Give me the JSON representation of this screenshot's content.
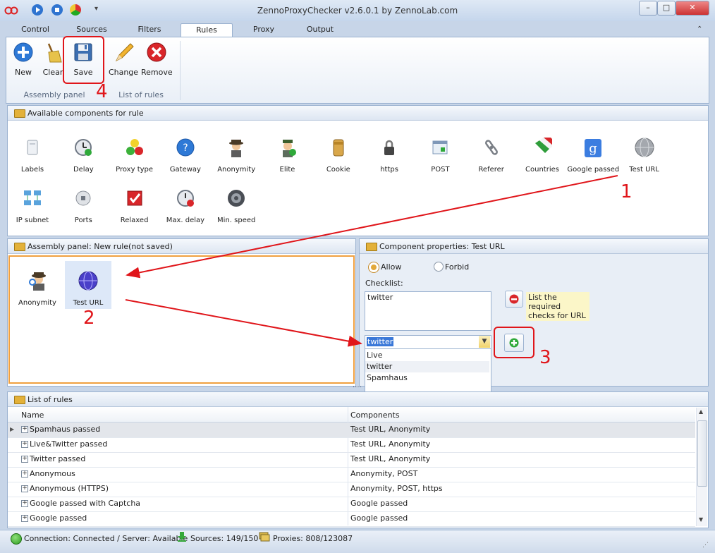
{
  "window": {
    "title": "ZennoProxyChecker v2.6.0.1 by ZennoLab.com",
    "minimize": "–",
    "maximize": "□",
    "close": "✕"
  },
  "tabs": [
    "Control",
    "Sources",
    "Filters",
    "Rules",
    "Proxy",
    "Output"
  ],
  "ribbon": {
    "buttons": {
      "new": "New",
      "clear": "Clear",
      "save": "Save",
      "change": "Change",
      "remove": "Remove"
    },
    "groups": {
      "assembly": "Assembly panel",
      "rules": "List of rules"
    }
  },
  "available": {
    "title": "Available components for rule",
    "row1": [
      "Labels",
      "Delay",
      "Proxy type",
      "Gateway",
      "Anonymity",
      "Elite",
      "Cookie",
      "https",
      "POST",
      "Referer",
      "Countries",
      "Google passed",
      "Test URL"
    ],
    "row2": [
      "IP subnet",
      "Ports",
      "Relaxed",
      "Max. delay",
      "Min. speed"
    ]
  },
  "assembly": {
    "title": "Assembly panel: New rule(not saved)",
    "items": [
      "Anonymity",
      "Test URL"
    ]
  },
  "props": {
    "title": "Component properties: Test URL",
    "allow": "Allow",
    "forbid": "Forbid",
    "checklist_label": "Checklist:",
    "checklist_items": [
      "twitter"
    ],
    "hint": "List the required checks for URL",
    "combo_value": "twitter",
    "dropdown_options": [
      "Live",
      "twitter",
      "Spamhaus"
    ]
  },
  "rules": {
    "title": "List of rules",
    "columns": [
      "Name",
      "Components"
    ],
    "rows": [
      {
        "name": "Spamhaus passed",
        "components": "Test URL, Anonymity"
      },
      {
        "name": "Live&Twitter passed",
        "components": "Test URL, Anonymity"
      },
      {
        "name": "Twitter passed",
        "components": "Test URL, Anonymity"
      },
      {
        "name": "Anonymous",
        "components": "Anonymity, POST"
      },
      {
        "name": "Anonymous (HTTPS)",
        "components": "Anonymity, POST, https"
      },
      {
        "name": "Google passed with Captcha",
        "components": "Google passed"
      },
      {
        "name": "Google passed",
        "components": "Google passed"
      }
    ]
  },
  "status": {
    "connection": "Connection: Connected / Server: Available",
    "sources": "Sources: 149/150",
    "proxies": "Proxies: 808/123087"
  },
  "annotations": [
    "1",
    "2",
    "3",
    "4"
  ],
  "colors": {
    "accent": "#e0151a",
    "panel_border": "#9bb2d0",
    "highlight": "#fbf6c8"
  }
}
